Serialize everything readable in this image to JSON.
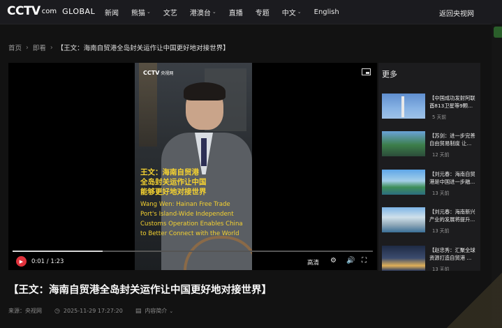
{
  "header": {
    "logo_main": "CCTV",
    "logo_com": "com",
    "logo_small": "央视网",
    "logo_global": "GLOBAL",
    "nav": [
      {
        "label": "新闻",
        "dropdown": false
      },
      {
        "label": "熊猫",
        "dropdown": true
      },
      {
        "label": "文艺",
        "dropdown": false
      },
      {
        "label": "港澳台",
        "dropdown": true
      },
      {
        "label": "直播",
        "dropdown": false
      },
      {
        "label": "专题",
        "dropdown": false
      },
      {
        "label": "中文",
        "dropdown": true
      },
      {
        "label": "English",
        "dropdown": false
      }
    ],
    "back_link": "返回央视网"
  },
  "breadcrumb": {
    "home": "首页",
    "section": "即看",
    "current": "【王文：海南自贸港全岛封关运作让中国更好地对接世界】",
    "separator": "›"
  },
  "player": {
    "watermark": "CCTV",
    "watermark_sub": "央视网",
    "caption_cn": [
      "王文：海南自贸港",
      "全岛封关运作让中国",
      "能够更好地对接世界"
    ],
    "caption_en": [
      "Wang Wen: Hainan Free Trade",
      "Port's Island-Wide Independent",
      "Customs Operation Enables China",
      "to Better Connect with the World"
    ],
    "time_current": "0:01",
    "time_total": "1:23",
    "time_display": "0:01 / 1:23",
    "progress": 0.25,
    "quality": "高清",
    "icons": {
      "pip": "pip-icon",
      "settings": "gear-icon",
      "volume": "volume-icon",
      "fullscreen": "fullscreen-icon"
    }
  },
  "sidebar": {
    "title": "更多",
    "items": [
      {
        "title": "【中国成功发射阿联酋813卫星等9颗...",
        "time": "5 天前"
      },
      {
        "title": "【苏剑：进一步完善自由贸易制度 让...",
        "time": "12 天前"
      },
      {
        "title": "【刘元春：海南自贸港是中国进一步融...",
        "time": "13 天前"
      },
      {
        "title": "【刘元春：海南新兴产业的发展将提升...",
        "time": "13 天前"
      },
      {
        "title": "【赵忠秀：汇聚全球资源打造自贸港 ...",
        "time": "13 天前"
      }
    ]
  },
  "article": {
    "headline": "【王文：海南自贸港全岛封关运作让中国更好地对接世界】",
    "source": "来源：央视网",
    "datetime": "2025-11-29 17:27:20",
    "summary_label": "内容简介"
  },
  "colors": {
    "background": "#121212",
    "nav_bg": "#1b1b1f",
    "caption": "#f5d230",
    "accent_red": "#e0323c"
  }
}
